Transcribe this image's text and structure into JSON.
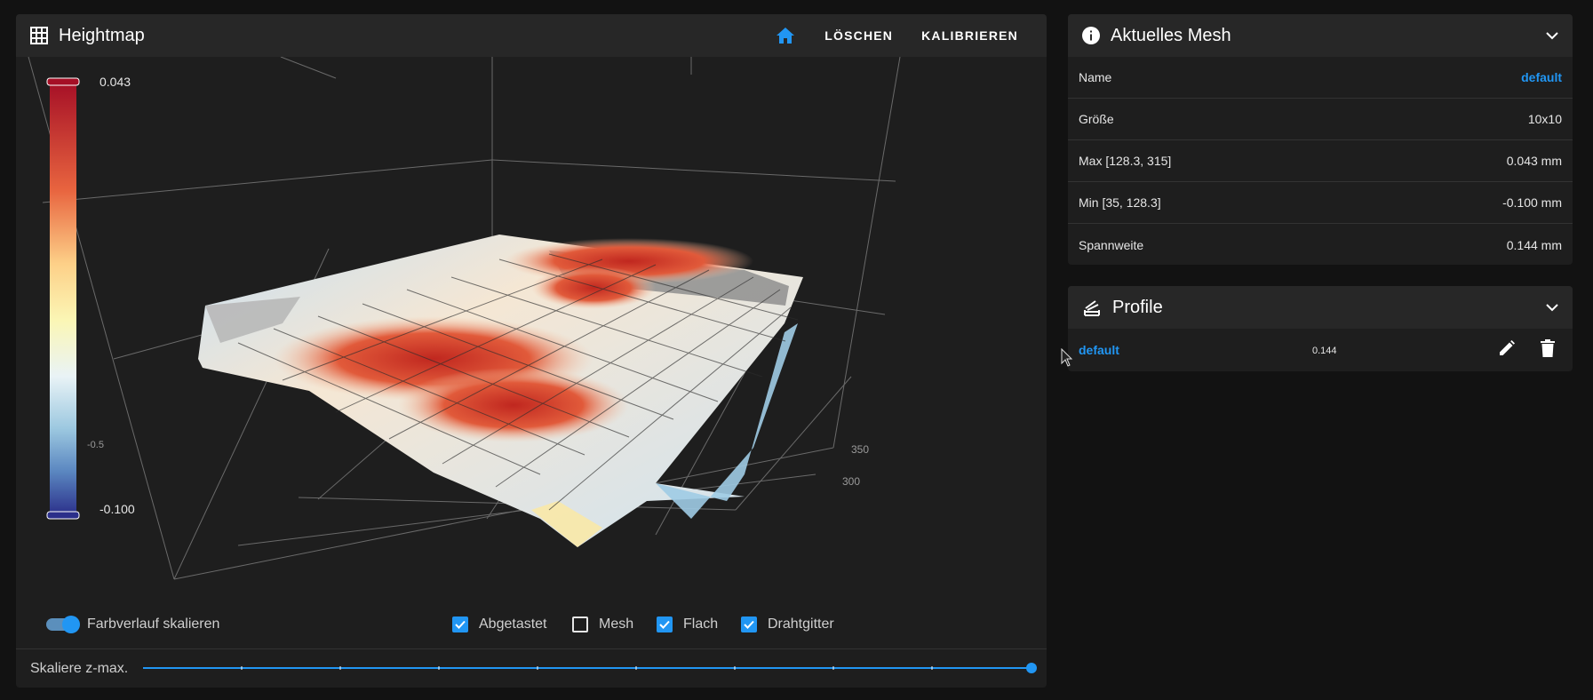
{
  "heightmap": {
    "title": "Heightmap",
    "icon": "grid-icon",
    "actions": {
      "home_icon": "home-icon",
      "clear": "LÖSCHEN",
      "calibrate": "KALIBRIEREN"
    },
    "colorbar": {
      "max": "0.043",
      "min": "-0.100",
      "mid_tick": "-0.5"
    },
    "axis_ticks": [
      "350",
      "300"
    ],
    "options": {
      "scale_gradient": {
        "label": "Farbverlauf skalieren",
        "checked": true
      },
      "probed": {
        "label": "Abgetastet",
        "checked": true
      },
      "mesh": {
        "label": "Mesh",
        "checked": false
      },
      "flat": {
        "label": "Flach",
        "checked": true
      },
      "wireframe": {
        "label": "Drahtgitter",
        "checked": true
      }
    },
    "zmax": {
      "label": "Skaliere z-max.",
      "value": 1.0
    },
    "colors": {
      "accent": "#2196f3",
      "high": "#b2182b",
      "mid": "#f7f7f7",
      "low": "#2b3a8f"
    }
  },
  "current_mesh": {
    "title": "Aktuelles Mesh",
    "icon": "info-icon",
    "rows": [
      {
        "label": "Name",
        "value": "default"
      },
      {
        "label": "Größe",
        "value": "10x10"
      },
      {
        "label": "Max [128.3, 315]",
        "value": "0.043 mm"
      },
      {
        "label": "Min [35, 128.3]",
        "value": "-0.100 mm"
      },
      {
        "label": "Spannweite",
        "value": "0.144 mm"
      }
    ]
  },
  "profiles": {
    "title": "Profile",
    "icon": "layers-icon",
    "items": [
      {
        "name": "default",
        "range": "0.144"
      }
    ]
  }
}
